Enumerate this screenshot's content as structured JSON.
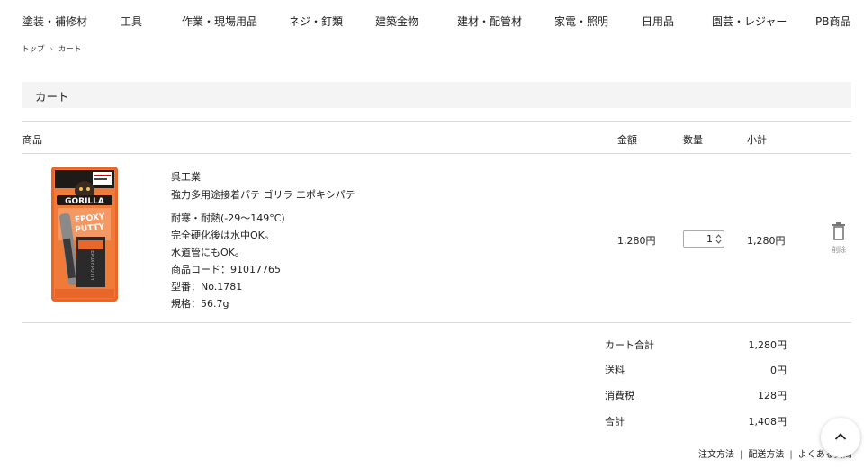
{
  "nav": [
    "塗装・補修材",
    "工具",
    "作業・現場用品",
    "ネジ・釘類",
    "建築金物",
    "建材・配管材",
    "家電・照明",
    "日用品",
    "園芸・レジャー",
    "PB商品"
  ],
  "breadcrumb": {
    "home": "トップ",
    "current": "カート"
  },
  "page_title": "カート",
  "table_headers": {
    "product": "商品",
    "price": "金額",
    "quantity": "数量",
    "subtotal": "小計"
  },
  "item": {
    "maker": "呉工業",
    "name": "強力多用途接着パテ ゴリラ エポキシパテ",
    "details": [
      "耐寒・耐熱(-29〜149°C)",
      "完全硬化後は水中OK。",
      "水道管にもOK。"
    ],
    "code": "商品コード：91017765",
    "model": "型番：No.1781",
    "spec": "規格：56.7g",
    "price": "1,280円",
    "quantity": "1",
    "subtotal": "1,280円",
    "delete_label": "削除",
    "package_text": {
      "brand": "GORILLA",
      "line1": "EPOXY",
      "line2": "PUTTY",
      "side": "EPOXY PUTTY"
    }
  },
  "summary": {
    "cart_total_label": "カート合計",
    "cart_total": "1,280円",
    "shipping_label": "送料",
    "shipping": "0円",
    "tax_label": "消費税",
    "tax": "128円",
    "total_label": "合計",
    "total": "1,408円"
  },
  "footer_links": [
    "注文方法",
    "配送方法",
    "よくある質問"
  ],
  "colors": {
    "package_orange": "#e8662a",
    "title_bar_bg": "#f4f4f4"
  }
}
